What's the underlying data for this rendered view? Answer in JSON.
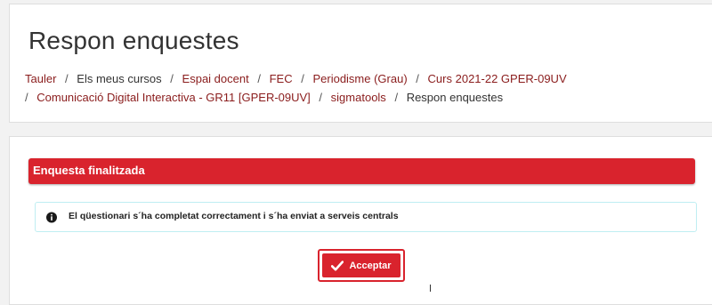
{
  "page": {
    "title": "Respon enquestes"
  },
  "breadcrumb": {
    "items": [
      {
        "label": "Tauler",
        "link": true
      },
      {
        "label": "Els meus cursos",
        "link": false
      },
      {
        "label": "Espai docent",
        "link": true
      },
      {
        "label": "FEC",
        "link": true
      },
      {
        "label": "Periodisme (Grau)",
        "link": true
      },
      {
        "label": "Curs 2021-22 GPER-09UV",
        "link": true
      },
      {
        "label": "Comunicació Digital Interactiva - GR11 [GPER-09UV]",
        "link": true
      },
      {
        "label": "sigmatools",
        "link": true
      },
      {
        "label": "Respon enquestes",
        "link": false
      }
    ],
    "separator": "/"
  },
  "banner": {
    "title": "Enquesta finalitzada",
    "color": "#d9232d"
  },
  "info": {
    "icon": "info-circle-icon",
    "message": "El qüestionari s´ha completat correctament i s´ha enviat a serveis centrals",
    "border_color": "#bfeef2"
  },
  "actions": {
    "accept_label": "Acceptar",
    "accept_icon": "check-icon",
    "accent": "#d9232d"
  },
  "colors": {
    "link": "#8a1c1c",
    "background": "#f2f2f2"
  }
}
